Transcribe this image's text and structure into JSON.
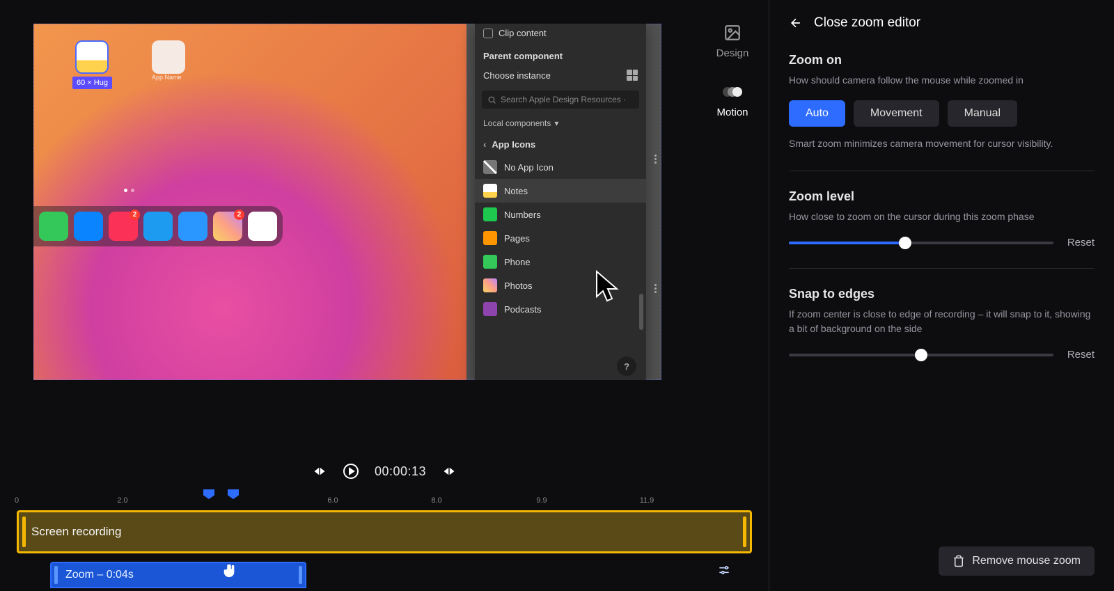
{
  "sideTabs": {
    "design": "Design",
    "motion": "Motion"
  },
  "figmaPanel": {
    "clipContent": "Clip content",
    "parentComponent": "Parent component",
    "chooseInstance": "Choose instance",
    "searchPlaceholder": "Search Apple Design Resources ·",
    "localComponents": "Local components",
    "appIcons": "App Icons",
    "items": [
      {
        "label": "No App Icon"
      },
      {
        "label": "Notes"
      },
      {
        "label": "Numbers"
      },
      {
        "label": "Pages"
      },
      {
        "label": "Phone"
      },
      {
        "label": "Photos"
      },
      {
        "label": "Podcasts"
      }
    ]
  },
  "selBadge": "60 × Hug",
  "appName": "App Name",
  "dockBadges": {
    "music": "2",
    "photos": "2"
  },
  "player": {
    "time": "00:00:13"
  },
  "ruler": [
    "0",
    "2.0",
    "",
    "6.0",
    "8.0",
    "9.9",
    "11.9"
  ],
  "tracks": {
    "screen": "Screen recording",
    "zoom": "Zoom – 0:04s"
  },
  "rightPanel": {
    "close": "Close zoom editor",
    "zoomOn": {
      "title": "Zoom on",
      "desc": "How should camera follow the mouse while zoomed in",
      "opts": [
        "Auto",
        "Movement",
        "Manual"
      ],
      "hint": "Smart zoom minimizes camera movement for cursor visibility."
    },
    "zoomLevel": {
      "title": "Zoom level",
      "desc": "How close to zoom on the cursor during this zoom phase",
      "reset": "Reset",
      "value": 0.44
    },
    "snap": {
      "title": "Snap to edges",
      "desc": "If zoom center is close to edge of recording – it will snap to it, showing a bit of background on the side",
      "reset": "Reset",
      "value": 0.5
    },
    "remove": "Remove mouse zoom"
  }
}
